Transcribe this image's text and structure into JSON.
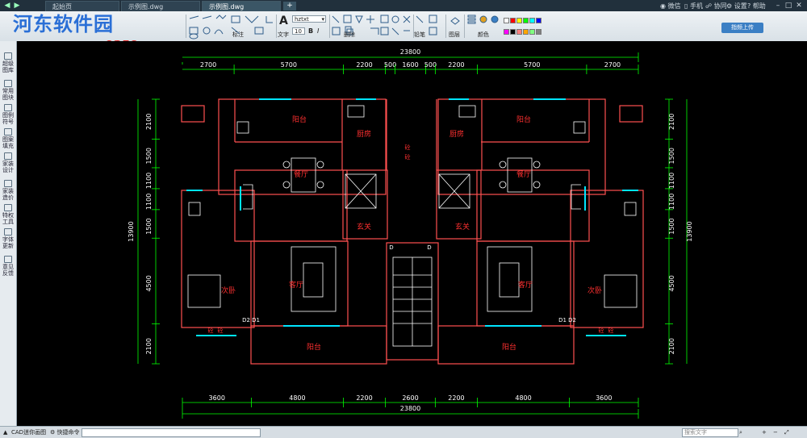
{
  "titlebar": {
    "tabs": [
      {
        "label": "起始页",
        "active": false
      },
      {
        "label": "示例图.dwg",
        "active": false
      },
      {
        "label": "示例图.dwg",
        "active": true
      }
    ],
    "right_links": [
      "微信",
      "手机",
      "协同",
      "设置",
      "帮助"
    ]
  },
  "watermark": {
    "title": "河东软件园",
    "url": "www.pc0359.cn"
  },
  "toolbar": {
    "labels": [
      "标注",
      "文字",
      "铅笔",
      "删除",
      "图层",
      "颜色"
    ],
    "font_name": "hztxt",
    "font_size": "10",
    "upload": "指频上传",
    "swatch_colors": [
      "#ffffff",
      "#ff0000",
      "#ffff00",
      "#00ff00",
      "#00ffff",
      "#0000ff",
      "#ff00ff",
      "#000000",
      "#ff8080",
      "#ffa500",
      "#80ff80",
      "#808080"
    ]
  },
  "sidebar": {
    "items": [
      "超级图库",
      "常用图块",
      "图例符号",
      "图案填充",
      "家装设计",
      "家装造价",
      "特权工具",
      "字体更新",
      "意见反馈"
    ]
  },
  "drawing": {
    "top_total": "23800",
    "top_dims": [
      "2700",
      "5700",
      "2200",
      "500",
      "1600",
      "500",
      "2200",
      "5700",
      "2700"
    ],
    "bottom_total": "23800",
    "bottom_dims": [
      "3600",
      "4800",
      "2200",
      "2600",
      "2200",
      "4800",
      "3600"
    ],
    "left_total": "13900",
    "left_dims": [
      "2100",
      "1500",
      "1100",
      "1100",
      "1500",
      "4500",
      "2100"
    ],
    "right_total": "13900",
    "right_dims": [
      "2100",
      "1500",
      "1100",
      "1100",
      "1500",
      "4500",
      "2100"
    ],
    "rooms": [
      {
        "name": "阳台"
      },
      {
        "name": "厨房"
      },
      {
        "name": "厨房"
      },
      {
        "name": "阳台"
      },
      {
        "name": "餐厅"
      },
      {
        "name": "餐厅"
      },
      {
        "name": "玄关"
      },
      {
        "name": "玄关"
      },
      {
        "name": "客厅"
      },
      {
        "name": "客厅"
      },
      {
        "name": "次卧"
      },
      {
        "name": "次卧"
      },
      {
        "name": "阳台"
      },
      {
        "name": "阳台"
      }
    ],
    "tags": [
      "D",
      "D",
      "D2",
      "D1",
      "D1",
      "D2",
      "砼",
      "砼",
      "砼",
      "砼",
      "砼",
      "砼"
    ]
  },
  "statusbar": {
    "left_label": "CAD迷你画图",
    "cmd_label": "快捷命令",
    "search_placeholder": "搜索文字"
  },
  "colors": {
    "wall": "#ff5050",
    "dimension": "#00ff00",
    "furniture": "#ffffff",
    "glass": "#00e5ff",
    "room_text": "#ff3030",
    "dim_text": "#ffffff"
  }
}
